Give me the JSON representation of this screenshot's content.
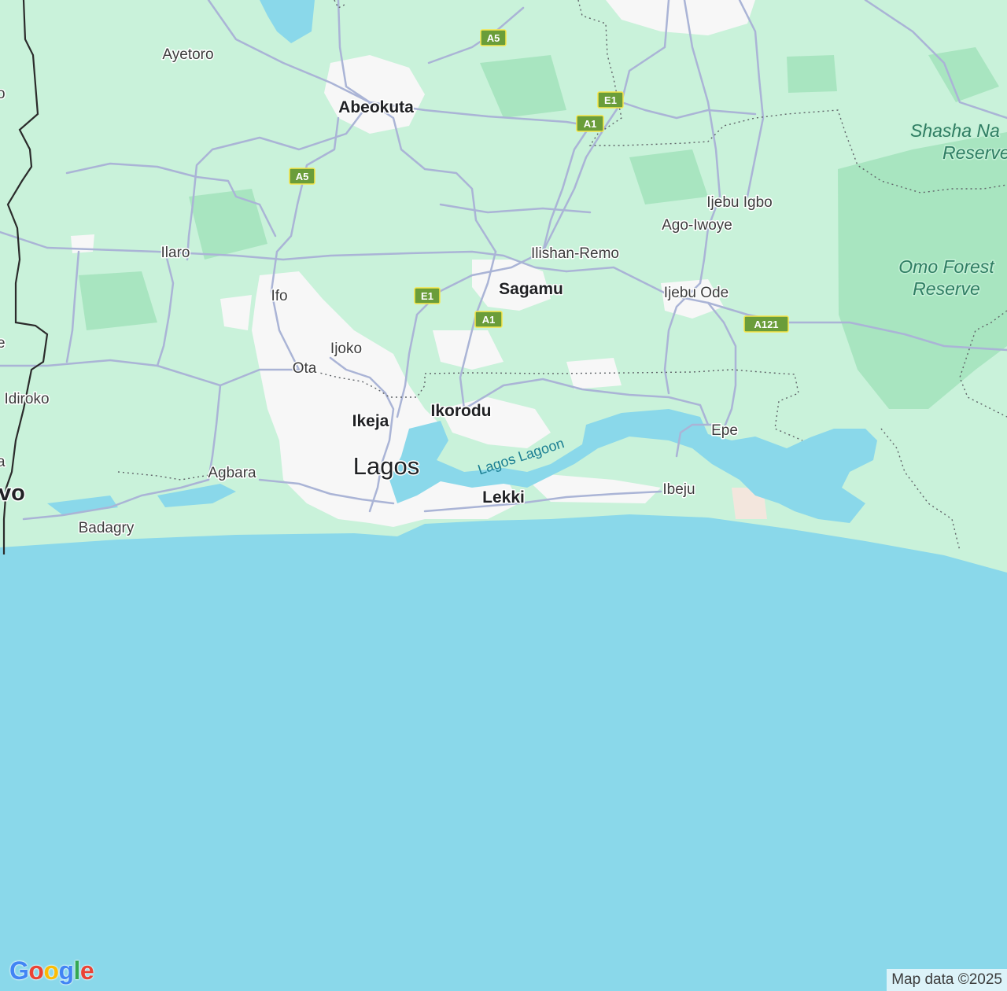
{
  "map": {
    "labels": {
      "abeokuta": "Abeokuta",
      "ayetoro": "Ayetoro",
      "ilaro": "Ilaro",
      "ifo": "Ifo",
      "ijoko": "Ijoko",
      "ota": "Ota",
      "idiroko": "Idiroko",
      "agbara": "Agbara",
      "badagry": "Badagry",
      "ikeja": "Ikeja",
      "lagos": "Lagos",
      "ikorodu": "Ikorodu",
      "lekki": "Lekki",
      "lagos_lagoon": "Lagos Lagoon",
      "sagamu": "Sagamu",
      "ilishan_remo": "Ilishan-Remo",
      "ijebu_igbo": "Ijebu Igbo",
      "ago_iwoye": "Ago-Iwoye",
      "ijebu_ode": "Ijebu Ode",
      "epe": "Epe",
      "ibeju": "Ibeju",
      "shasha_line1": "Shasha Na",
      "shasha_line2": "Reserve",
      "omo_line1": "Omo Forest",
      "omo_line2": "Reserve",
      "edge_vo": "vo",
      "edge_o": "o",
      "edge_e": "e",
      "edge_a": "a"
    },
    "highway_shields": {
      "a5_north": "A5",
      "a5_west": "A5",
      "e1_north": "E1",
      "a1_north": "A1",
      "e1_south": "E1",
      "a1_south": "A1",
      "a121": "A121"
    },
    "colors": {
      "land": "#c9f2da",
      "forest": "#a8e5c0",
      "urban": "#f7f7f7",
      "water": "#8ad8ea",
      "road": "#aab4d6",
      "shield": "#6a9d3a"
    },
    "attribution": "Map data ©2025",
    "logo": {
      "letters": [
        "G",
        "o",
        "o",
        "g",
        "l",
        "e"
      ],
      "colors": [
        "#4285f4",
        "#ea4335",
        "#fbbc05",
        "#4285f4",
        "#34a853",
        "#ea4335"
      ]
    }
  }
}
